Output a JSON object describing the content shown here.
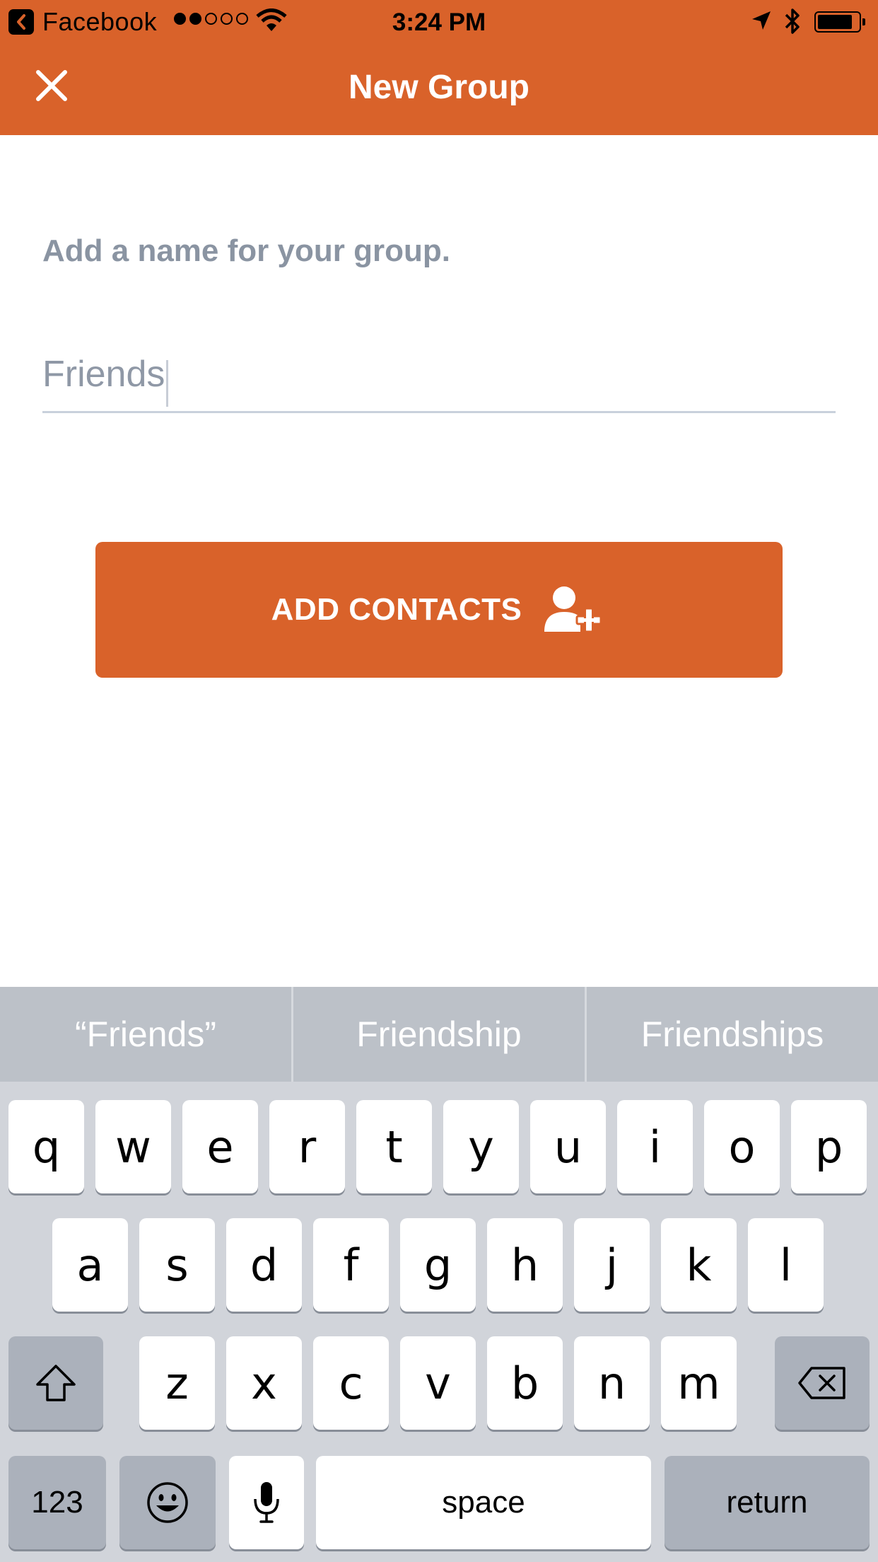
{
  "status_bar": {
    "back_app": "Facebook",
    "time": "3:24 PM",
    "signal_filled": 2,
    "signal_total": 5,
    "battery_level": 0.8
  },
  "nav": {
    "title": "New Group",
    "close_icon": "close-icon"
  },
  "form": {
    "prompt": "Add a name for your group.",
    "group_name_value": "Friends"
  },
  "add_contacts": {
    "label": "ADD CONTACTS",
    "icon": "add-user-icon"
  },
  "keyboard": {
    "suggestions": [
      "“Friends”",
      "Friendship",
      "Friendships"
    ],
    "row1": [
      "q",
      "w",
      "e",
      "r",
      "t",
      "y",
      "u",
      "i",
      "o",
      "p"
    ],
    "row2": [
      "a",
      "s",
      "d",
      "f",
      "g",
      "h",
      "j",
      "k",
      "l"
    ],
    "row3": [
      "z",
      "x",
      "c",
      "v",
      "b",
      "n",
      "m"
    ],
    "numbers_key": "123",
    "space_key": "space",
    "return_key": "return",
    "icons": [
      "shift-icon",
      "backspace-icon",
      "emoji-icon",
      "microphone-icon"
    ]
  },
  "colors": {
    "accent": "#d9622a",
    "prompt_text": "#8a94a2",
    "keyboard_bg": "#d1d4da",
    "suggestion_bar": "#bcc1c8"
  }
}
